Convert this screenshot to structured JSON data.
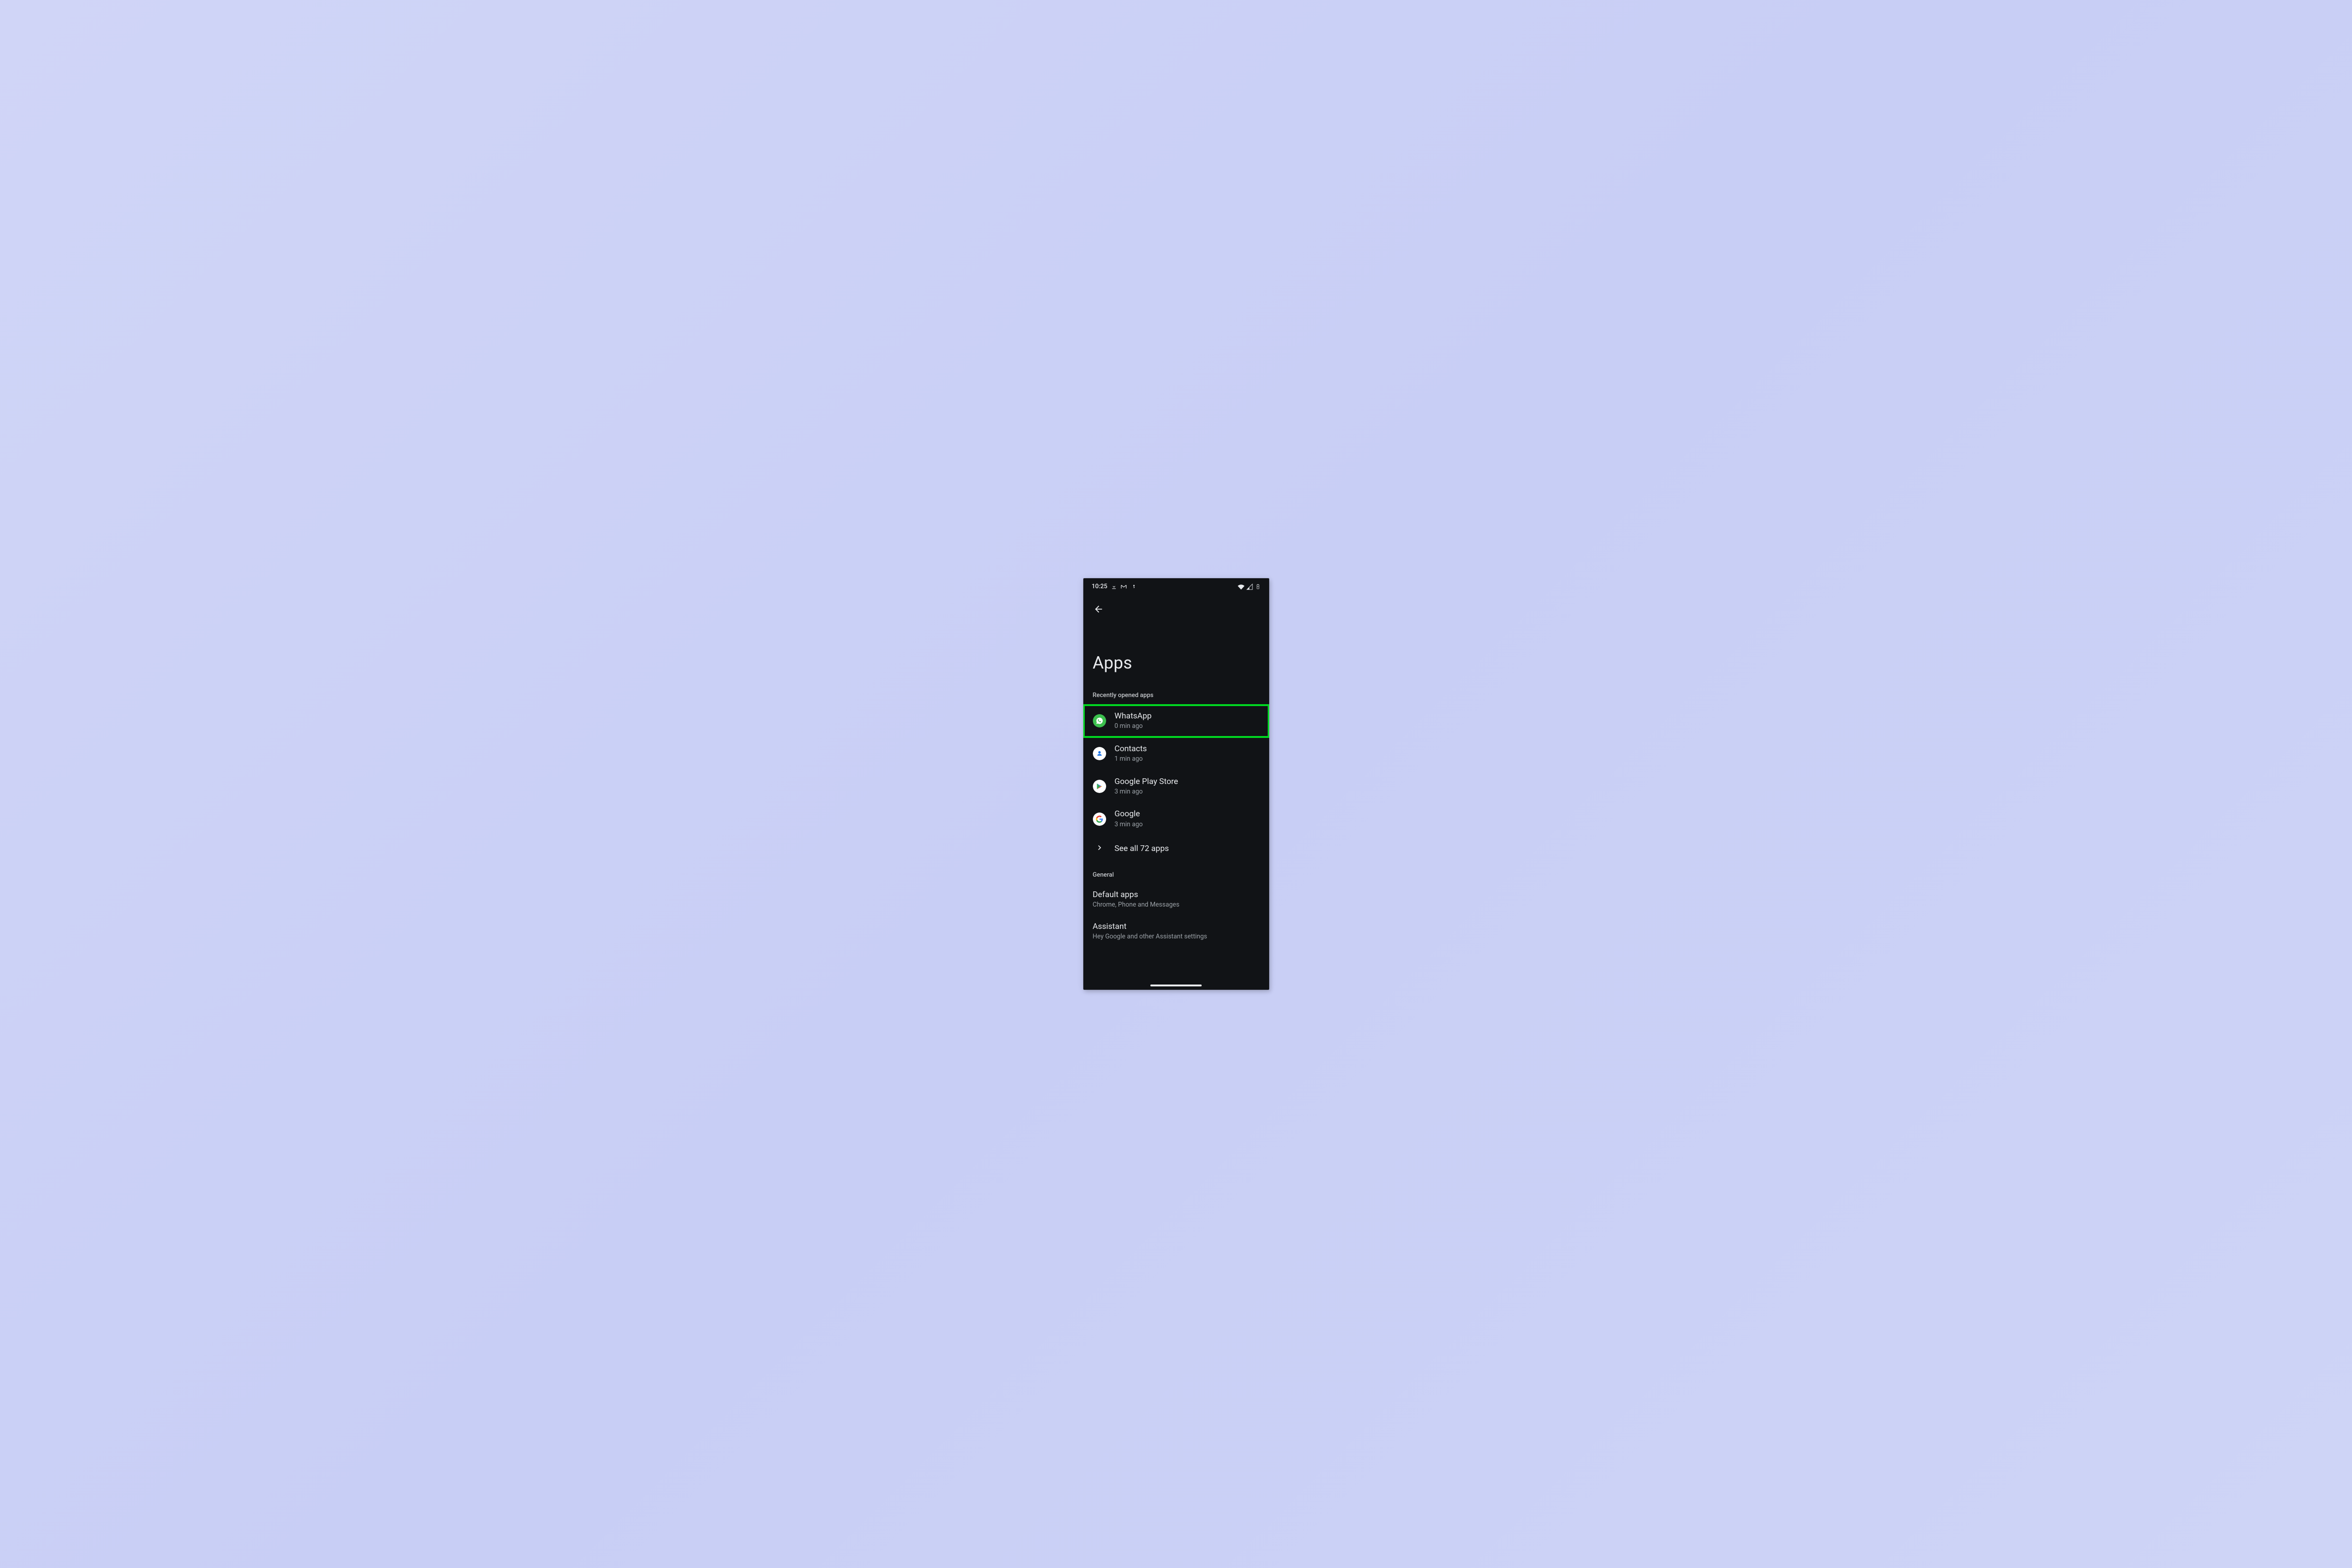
{
  "statusbar": {
    "time": "10:25"
  },
  "header": {
    "title": "Apps"
  },
  "recent": {
    "section_label": "Recently opened apps",
    "items": [
      {
        "name": "WhatsApp",
        "sub": "0 min ago"
      },
      {
        "name": "Contacts",
        "sub": "1 min ago"
      },
      {
        "name": "Google Play Store",
        "sub": "3 min ago"
      },
      {
        "name": "Google",
        "sub": "3 min ago"
      }
    ],
    "see_all_label": "See all 72 apps"
  },
  "general": {
    "section_label": "General",
    "items": [
      {
        "name": "Default apps",
        "sub": "Chrome, Phone and Messages"
      },
      {
        "name": "Assistant",
        "sub": "Hey Google and other Assistant settings"
      }
    ]
  }
}
